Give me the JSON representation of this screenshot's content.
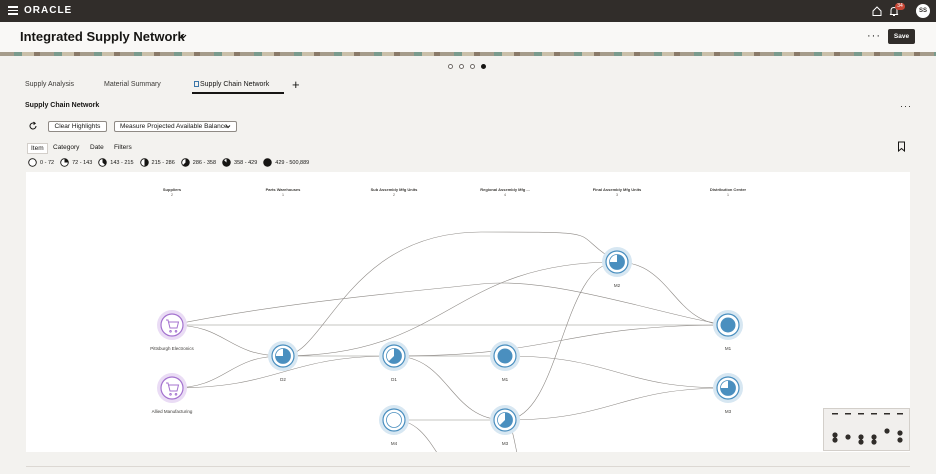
{
  "app": {
    "brand": "ORACLE",
    "notification_count": "34",
    "user_initials": "SS"
  },
  "header": {
    "title": "Integrated Supply Network",
    "more": "···",
    "save_label": "Save"
  },
  "carousel": {
    "pages": 4,
    "active": 4
  },
  "tabs": [
    {
      "label": "Supply Analysis",
      "active": false
    },
    {
      "label": "Material Summary",
      "active": false
    },
    {
      "label": "Supply Chain Network",
      "active": true
    }
  ],
  "add_tab": "+",
  "section": {
    "title": "Supply Chain Network",
    "more": "···"
  },
  "toolbar": {
    "clear_label": "Clear Highlights",
    "measure_label": "Measure Projected Available Balance"
  },
  "filters": [
    "Item",
    "Category",
    "Date",
    "Filters"
  ],
  "legend": [
    {
      "label": "0 - 72",
      "fill": 0
    },
    {
      "label": "72 - 143",
      "fill": 0.25
    },
    {
      "label": "143 - 215",
      "fill": 0.375
    },
    {
      "label": "215 - 286",
      "fill": 0.5
    },
    {
      "label": "286 - 358",
      "fill": 0.625
    },
    {
      "label": "358 - 429",
      "fill": 0.875
    },
    {
      "label": "429 - 500,889",
      "fill": 1
    }
  ],
  "network": {
    "columns": [
      {
        "name": "Suppliers",
        "count": "2"
      },
      {
        "name": "Parts Warehouses",
        "count": "1"
      },
      {
        "name": "Sub Assembly Mfg Units",
        "count": "2"
      },
      {
        "name": "Regional Assembly Mfg ...",
        "count": "4"
      },
      {
        "name": "Final Assembly Mfg Units",
        "count": "3"
      },
      {
        "name": "Distribution Center",
        "count": "1"
      }
    ],
    "nodes": [
      {
        "id": "pittsburgh",
        "label": "Pittsburgh Electronics",
        "kind": "supplier",
        "icon": "cart-icon"
      },
      {
        "id": "allied",
        "label": "Allied Manufacturing",
        "kind": "supplier",
        "icon": "cart-icon"
      },
      {
        "id": "d2",
        "label": "D2",
        "kind": "site",
        "fill": 0.75
      },
      {
        "id": "d1",
        "label": "D1",
        "kind": "site",
        "fill": 0.625
      },
      {
        "id": "m4",
        "label": "M4",
        "kind": "site",
        "fill": 0
      },
      {
        "id": "m1a",
        "label": "M1",
        "kind": "site",
        "fill": 1
      },
      {
        "id": "m3a",
        "label": "M3",
        "kind": "site",
        "fill": 0.625
      },
      {
        "id": "m2",
        "label": "M2",
        "kind": "site",
        "fill": 0.75
      },
      {
        "id": "m1b",
        "label": "M1",
        "kind": "site",
        "fill": 1
      },
      {
        "id": "m3b",
        "label": "M3",
        "kind": "site",
        "fill": 0.75
      }
    ],
    "edges": [
      [
        "pittsburgh",
        "m1b"
      ],
      [
        "pittsburgh",
        "d2"
      ],
      [
        "allied",
        "d2"
      ],
      [
        "allied",
        "d1"
      ],
      [
        "d2",
        "d1"
      ],
      [
        "d2",
        "m2"
      ],
      [
        "d1",
        "m1a"
      ],
      [
        "d1",
        "m1b"
      ],
      [
        "d1",
        "m3a"
      ],
      [
        "m4",
        "m3a"
      ],
      [
        "m1a",
        "m3b"
      ],
      [
        "m3a",
        "m2"
      ],
      [
        "m2",
        "m1b"
      ],
      [
        "m3a",
        "m3b"
      ]
    ]
  },
  "colors": {
    "accent": "#3a76a8",
    "node_fill": "#4a8fbf",
    "node_ring": "#d7e7f2",
    "supplier": "#a473cf",
    "supplier_ring": "#eadcf5"
  }
}
